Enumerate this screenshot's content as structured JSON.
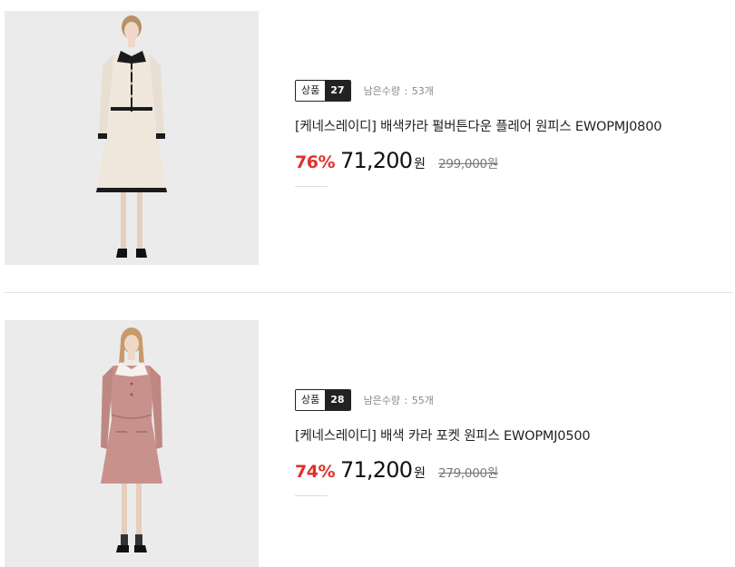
{
  "products": [
    {
      "badge_label": "상품",
      "badge_number": "27",
      "stock_label": "남은수량",
      "stock_value": "53개",
      "title": "[케네스레이디] 배색카라 펄버튼다운 플레어 원피스 EWOPMJ0800",
      "discount": "76%",
      "price": "71,200",
      "currency": "원",
      "original_price": "299,000원",
      "dress_color": "#efe7dc",
      "collar_color": "#1b1b1b"
    },
    {
      "badge_label": "상품",
      "badge_number": "28",
      "stock_label": "남은수량",
      "stock_value": "55개",
      "title": "[케네스레이디] 배색 카라 포켓 원피스 EWOPMJ0500",
      "discount": "74%",
      "price": "71,200",
      "currency": "원",
      "original_price": "279,000원",
      "dress_color": "#c9918c",
      "collar_color": "#f6f2ee"
    }
  ],
  "colors": {
    "discount_red": "#e0312d",
    "badge_dark": "#222222",
    "divider": "#e3e3e3",
    "image_background": "#ebebec"
  }
}
